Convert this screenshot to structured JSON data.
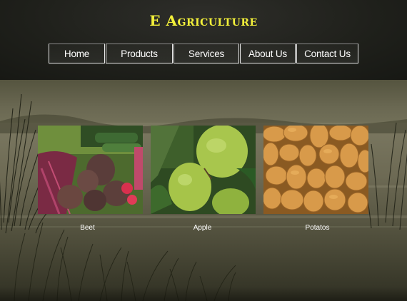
{
  "header": {
    "site_title": "E Agriculture"
  },
  "nav": {
    "items": [
      {
        "label": "Home"
      },
      {
        "label": "Products"
      },
      {
        "label": "Services"
      },
      {
        "label": "About Us"
      },
      {
        "label": "Contact Us"
      }
    ]
  },
  "products": [
    {
      "name": "Beet",
      "icon": "beet-image"
    },
    {
      "name": "Apple",
      "icon": "apple-image"
    },
    {
      "name": "Potatos",
      "icon": "potato-image"
    }
  ],
  "colors": {
    "title": "#f3f03a",
    "nav_text": "#ffffff",
    "header_bg": "#1f201b"
  }
}
